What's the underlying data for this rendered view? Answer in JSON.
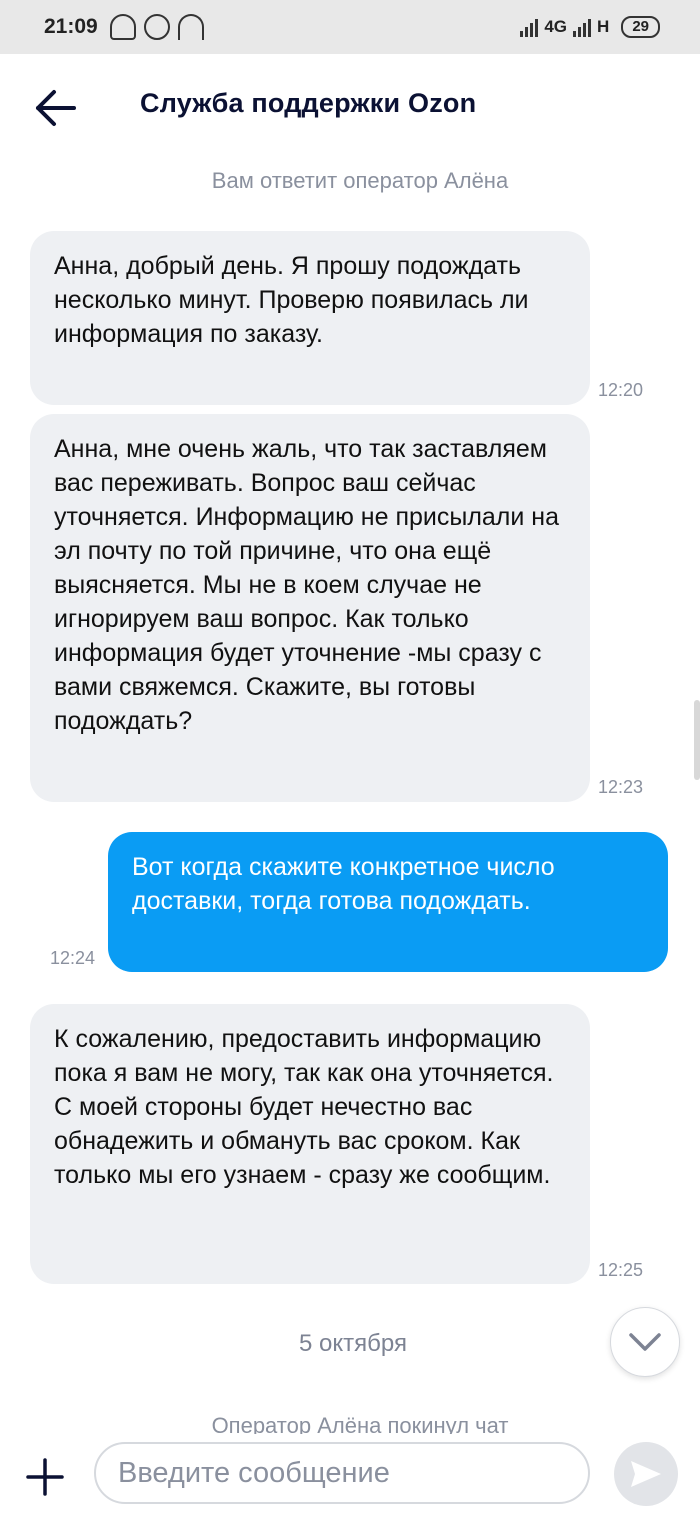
{
  "status_bar": {
    "time": "21:09",
    "network_1": "4G",
    "network_2": "H",
    "battery": "29"
  },
  "header": {
    "title": "Служба поддержки Ozon"
  },
  "chat": {
    "operator_note": "Вам ответит оператор Алёна",
    "messages": [
      {
        "from": "operator",
        "text": "Анна, добрый день. Я прошу подождать несколько минут. Проверю появилась ли информация по заказу.",
        "time": "12:20"
      },
      {
        "from": "operator",
        "text": "Анна, мне очень жаль, что так заставляем вас переживать. Вопрос ваш сейчас уточняется. Информацию не присылали на эл почту по той причине, что она ещё выясняется. Мы не в коем случае не игнорируем ваш вопрос. Как только информация будет уточнение -мы сразу с вами свяжемся. Скажите, вы готовы подождать?",
        "time": "12:23"
      },
      {
        "from": "user",
        "text": "Вот когда скажите конкретное число доставки, тогда готова подождать.",
        "time": "12:24"
      },
      {
        "from": "operator",
        "text": "К сожалению, предоставить информацию пока я вам не могу, так как она уточняется. С моей стороны будет нечестно вас обнадежить и обмануть вас сроком. Как только мы его узнаем - сразу же сообщим.",
        "time": "12:25"
      }
    ],
    "date_separator": "5 октября",
    "operator_left_note": "Оператор Алёна покинул чат"
  },
  "input": {
    "placeholder": "Введите сообщение"
  },
  "colors": {
    "accent": "#0a9cf4",
    "incoming_bubble": "#eef0f3",
    "muted_text": "#8a909e"
  }
}
